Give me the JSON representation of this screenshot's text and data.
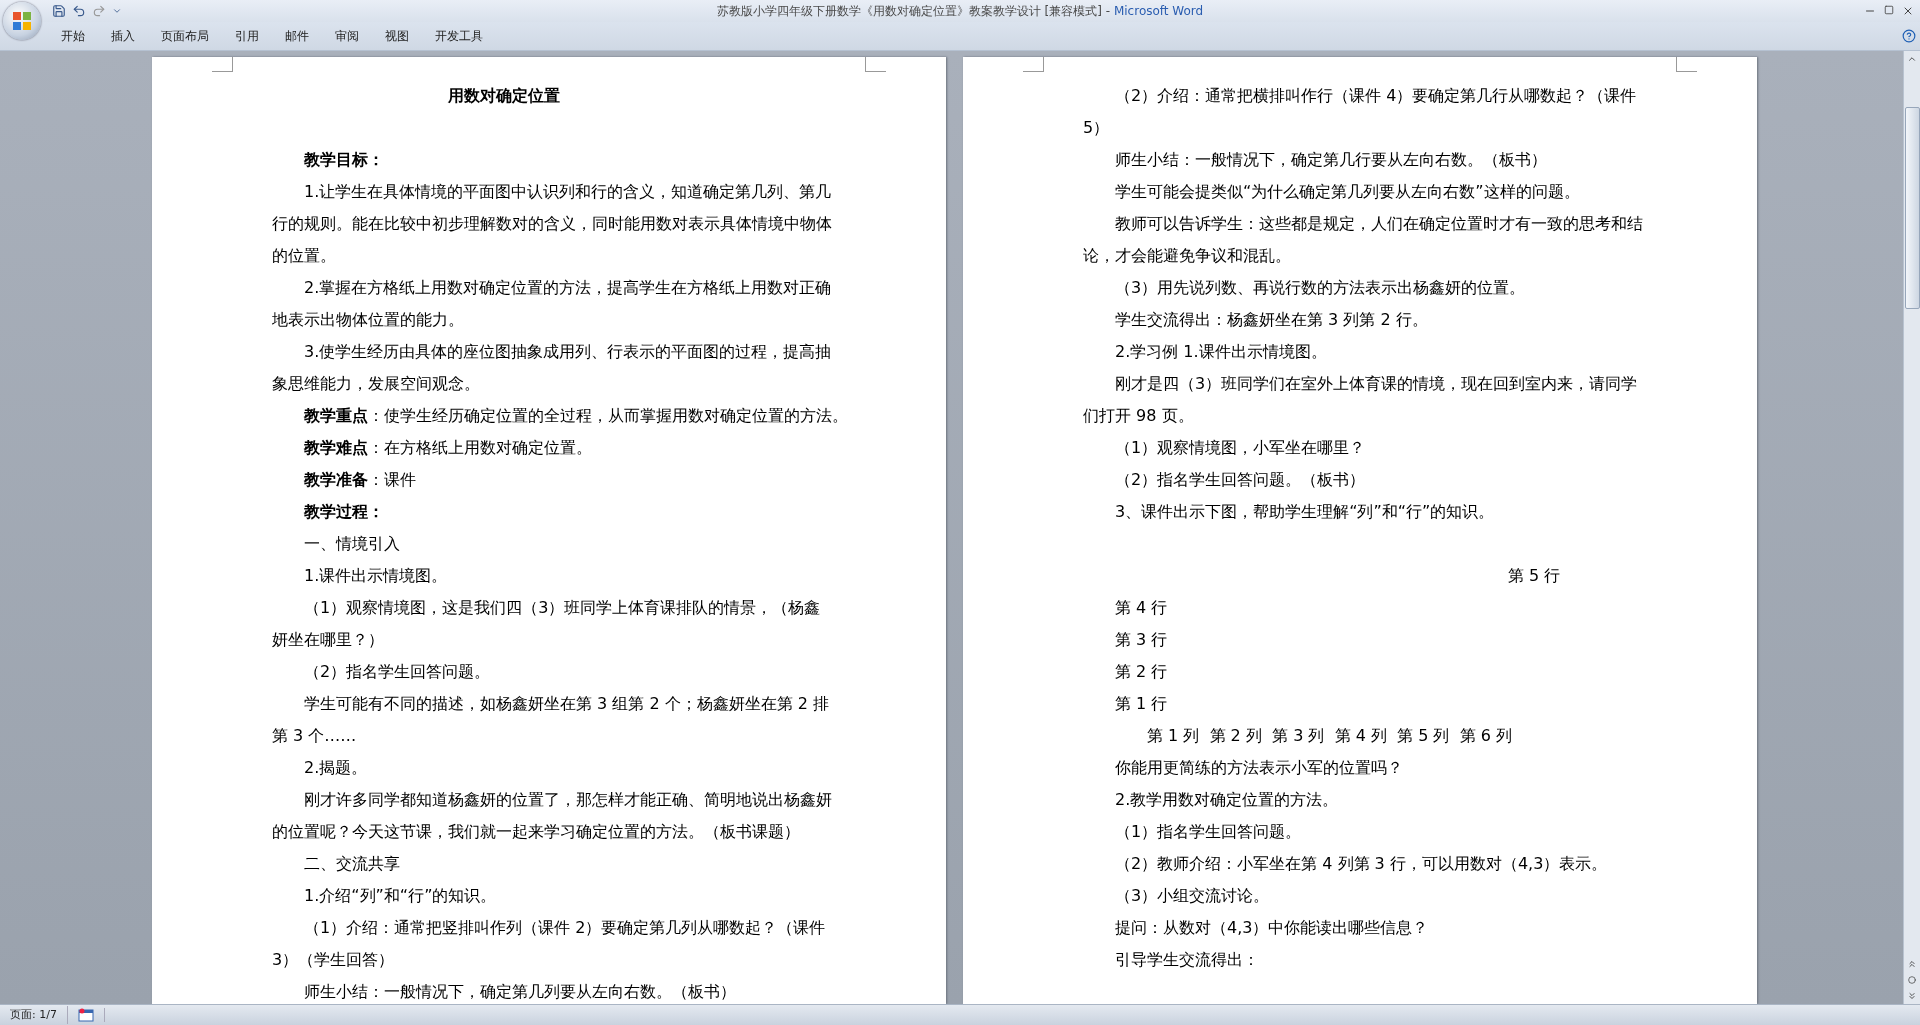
{
  "window": {
    "title": "苏教版小学四年级下册数学《用数对确定位置》教案教学设计 [兼容模式] - ",
    "app": "Microsoft Word"
  },
  "tabs": [
    {
      "label": "开始"
    },
    {
      "label": "插入"
    },
    {
      "label": "页面布局"
    },
    {
      "label": "引用"
    },
    {
      "label": "邮件"
    },
    {
      "label": "审阅"
    },
    {
      "label": "视图"
    },
    {
      "label": "开发工具"
    }
  ],
  "pages": [
    {
      "paragraphs": [
        {
          "kind": "title",
          "lines": [
            "用数对确定位置"
          ]
        },
        {
          "kind": "blank"
        },
        {
          "kind": "body",
          "lines": [
            "教学目标："
          ],
          "bold": true
        },
        {
          "kind": "body",
          "lines": [
            "1.让学生在具体情境的平面图中认识列和行的含义，知道确定第几列、第几",
            "行的规则。能在比较中初步理解数对的含义，同时能用数对表示具体情境中物体",
            "的位置。"
          ],
          "bold": false
        },
        {
          "kind": "body",
          "lines": [
            "2.掌握在方格纸上用数对确定位置的方法，提高学生在方格纸上用数对正确",
            "地表示出物体位置的能力。"
          ],
          "bold": false
        },
        {
          "kind": "body",
          "lines": [
            "3.使学生经历由具体的座位图抽象成用列、行表示的平面图的过程，提高抽",
            "象思维能力，发展空间观念。"
          ],
          "bold": false
        },
        {
          "kind": "body",
          "lines": [
            "**教学重点**：使学生经历确定位置的全过程，从而掌握用数对确定位置的方法。"
          ],
          "bold": false
        },
        {
          "kind": "body",
          "lines": [
            "**教学难点**：在方格纸上用数对确定位置。"
          ],
          "bold": false
        },
        {
          "kind": "body",
          "lines": [
            "**教学准备**：课件"
          ],
          "bold": false
        },
        {
          "kind": "body",
          "lines": [
            "教学过程："
          ],
          "bold": true
        },
        {
          "kind": "body",
          "lines": [
            "一、情境引入"
          ],
          "bold": false
        },
        {
          "kind": "body",
          "lines": [
            "1.课件出示情境图。"
          ],
          "bold": false
        },
        {
          "kind": "body",
          "lines": [
            "（1）观察情境图，这是我们四（3）班同学上体育课排队的情景，（杨鑫",
            "妍坐在哪里？）"
          ],
          "bold": false
        },
        {
          "kind": "body",
          "lines": [
            "（2）指名学生回答问题。"
          ],
          "bold": false
        },
        {
          "kind": "body",
          "lines": [
            "学生可能有不同的描述，如杨鑫妍坐在第 3 组第 2 个；杨鑫妍坐在第 2 排",
            "第 3 个……"
          ],
          "bold": false
        },
        {
          "kind": "body",
          "lines": [
            "2.揭题。"
          ],
          "bold": false
        },
        {
          "kind": "body",
          "lines": [
            "刚才许多同学都知道杨鑫妍的位置了，那怎样才能正确、简明地说出杨鑫妍",
            "的位置呢？今天这节课，我们就一起来学习确定位置的方法。（板书课题）"
          ],
          "bold": false
        },
        {
          "kind": "body",
          "lines": [
            "二、交流共享"
          ],
          "bold": false
        },
        {
          "kind": "body",
          "lines": [
            "1.介绍“列”和“行”的知识。"
          ],
          "bold": false
        },
        {
          "kind": "body",
          "lines": [
            "（1）介绍：通常把竖排叫作列（课件 2）要确定第几列从哪数起？（课件",
            "3）（学生回答）"
          ],
          "bold": false
        },
        {
          "kind": "body",
          "lines": [
            "师生小结：一般情况下，确定第几列要从左向右数。（板书）"
          ],
          "bold": false
        }
      ]
    },
    {
      "paragraphs": [
        {
          "kind": "body",
          "lines": [
            "（2）介绍：通常把横排叫作行（课件 4）要确定第几行从哪数起？（课件",
            "5）"
          ],
          "bold": false
        },
        {
          "kind": "body",
          "lines": [
            "师生小结：一般情况下，确定第几行要从左向右数。（板书）"
          ],
          "bold": false
        },
        {
          "kind": "body",
          "lines": [
            "学生可能会提类似“为什么确定第几列要从左向右数”这样的问题。"
          ],
          "bold": false
        },
        {
          "kind": "body",
          "lines": [
            "教师可以告诉学生：这些都是规定，人们在确定位置时才有一致的思考和结",
            "论，才会能避免争议和混乱。"
          ],
          "bold": false
        },
        {
          "kind": "body",
          "lines": [
            "（3）用先说列数、再说行数的方法表示出杨鑫妍的位置。"
          ],
          "bold": false
        },
        {
          "kind": "body",
          "lines": [
            "学生交流得出：杨鑫妍坐在第 3 列第 2 行。"
          ],
          "bold": false
        },
        {
          "kind": "body",
          "lines": [
            "2.学习例 1.课件出示情境图。"
          ],
          "bold": false
        },
        {
          "kind": "body",
          "lines": [
            "刚才是四（3）班同学们在室外上体育课的情境，现在回到室内来，请同学",
            "们打开 98 页。"
          ],
          "bold": false
        },
        {
          "kind": "body",
          "lines": [
            "（1）观察情境图，小军坐在哪里？"
          ],
          "bold": false
        },
        {
          "kind": "body",
          "lines": [
            "（2）指名学生回答问题。（板书）"
          ],
          "bold": false
        },
        {
          "kind": "body",
          "lines": [
            "3、课件出示下图，帮助学生理解“列”和“行”的知识。"
          ],
          "bold": false
        },
        {
          "kind": "blank"
        },
        {
          "kind": "far",
          "lines": [
            "第 5 行"
          ]
        },
        {
          "kind": "body",
          "lines": [
            "第 4 行"
          ],
          "bold": false
        },
        {
          "kind": "body",
          "lines": [
            "第 3 行"
          ],
          "bold": false
        },
        {
          "kind": "body",
          "lines": [
            "第 2 行"
          ],
          "bold": false
        },
        {
          "kind": "body",
          "lines": [
            "第 1 行"
          ],
          "bold": false
        },
        {
          "kind": "deep",
          "lines": [
            "第 1 列  第 2 列  第 3 列  第 4 列  第 5 列  第 6 列"
          ]
        },
        {
          "kind": "body",
          "lines": [
            "你能用更简练的方法表示小军的位置吗？"
          ],
          "bold": false
        },
        {
          "kind": "body",
          "lines": [
            "2.教学用数对确定位置的方法。"
          ],
          "bold": false
        },
        {
          "kind": "body",
          "lines": [
            "（1）指名学生回答问题。"
          ],
          "bold": false
        },
        {
          "kind": "body",
          "lines": [
            "（2）教师介绍：小军坐在第 4 列第 3 行，可以用数对（4,3）表示。"
          ],
          "bold": false
        },
        {
          "kind": "body",
          "lines": [
            "（3）小组交流讨论。"
          ],
          "bold": false
        },
        {
          "kind": "body",
          "lines": [
            "提问：从数对（4,3）中你能读出哪些信息？"
          ],
          "bold": false
        },
        {
          "kind": "body",
          "lines": [
            "引导学生交流得出："
          ],
          "bold": false
        }
      ]
    }
  ],
  "status_bar": {
    "page": "页面: 1/7"
  }
}
